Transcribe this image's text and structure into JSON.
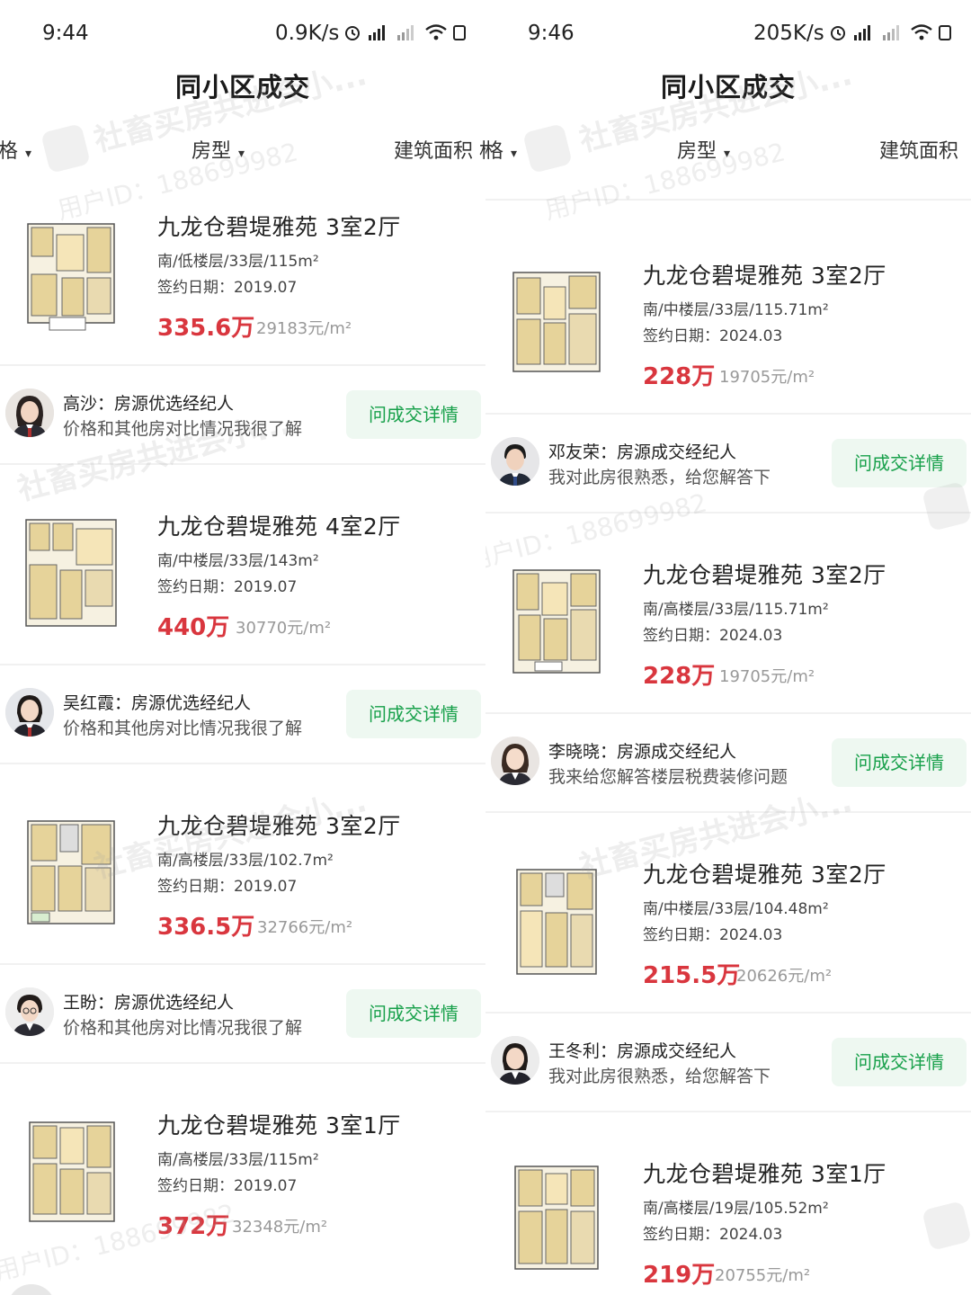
{
  "left": {
    "status": {
      "time": "9:44",
      "net_speed": "0.9K/s"
    },
    "title": "同小区成交",
    "filters": [
      {
        "label": "格"
      },
      {
        "label": "房型"
      },
      {
        "label": "建筑面积 格"
      }
    ],
    "listings": [
      {
        "name": "九龙仓碧堤雅苑 3室2厅",
        "meta": "南/低楼层/33层/115m²",
        "date": "签约日期：2019.07",
        "price": "335.6万",
        "unit_price": "29183元/m²"
      },
      {
        "name": "九龙仓碧堤雅苑 4室2厅",
        "meta": "南/中楼层/33层/143m²",
        "date": "签约日期：2019.07",
        "price": "440万",
        "unit_price": "30770元/m²"
      },
      {
        "name": "九龙仓碧堤雅苑 3室2厅",
        "meta": "南/高楼层/33层/102.7m²",
        "date": "签约日期：2019.07",
        "price": "336.5万",
        "unit_price": "32766元/m²"
      },
      {
        "name": "九龙仓碧堤雅苑 3室1厅",
        "meta": "南/高楼层/33层/115m²",
        "date": "签约日期：2019.07",
        "price": "372万",
        "unit_price": "32348元/m²"
      }
    ],
    "agents": [
      {
        "name": "高沙：房源优选经纪人",
        "message": "价格和其他房对比情况我很了解",
        "button": "问成交详情"
      },
      {
        "name": "吴红霞：房源优选经纪人",
        "message": "价格和其他房对比情况我很了解",
        "button": "问成交详情"
      },
      {
        "name": "王盼：房源优选经纪人",
        "message": "价格和其他房对比情况我很了解",
        "button": "问成交详情"
      }
    ]
  },
  "right": {
    "status": {
      "time": "9:46",
      "net_speed": "205K/s"
    },
    "title": "同小区成交",
    "filters": [
      {
        "label": "格"
      },
      {
        "label": "房型"
      },
      {
        "label": "建筑面积"
      }
    ],
    "listings": [
      {
        "name": "九龙仓碧堤雅苑 3室2厅",
        "meta": "南/中楼层/33层/115.71m²",
        "date": "签约日期：2024.03",
        "price": "228万",
        "unit_price": "19705元/m²"
      },
      {
        "name": "九龙仓碧堤雅苑 3室2厅",
        "meta": "南/高楼层/33层/115.71m²",
        "date": "签约日期：2024.03",
        "price": "228万",
        "unit_price": "19705元/m²"
      },
      {
        "name": "九龙仓碧堤雅苑 3室2厅",
        "meta": "南/中楼层/33层/104.48m²",
        "date": "签约日期：2024.03",
        "price": "215.5万",
        "unit_price": "20626元/m²"
      },
      {
        "name": "九龙仓碧堤雅苑 3室1厅",
        "meta": "南/高楼层/19层/105.52m²",
        "date": "签约日期：2024.03",
        "price": "219万",
        "unit_price": "20755元/m²"
      }
    ],
    "agents": [
      {
        "name": "邓友荣：房源成交经纪人",
        "message": "我对此房很熟悉，给您解答下",
        "button": "问成交详情"
      },
      {
        "name": "李晓晓：房源成交经纪人",
        "message": "我来给您解答楼层税费装修问题",
        "button": "问成交详情"
      },
      {
        "name": "王冬利：房源成交经纪人",
        "message": "我对此房很熟悉，给您解答下",
        "button": "问成交详情"
      }
    ]
  },
  "watermark": {
    "text": "社畜买房共进会小...",
    "user_id": "用户ID：188699982"
  },
  "colors": {
    "price": "#d9363e",
    "button_text": "#17a04a",
    "button_bg": "#eef8f1"
  }
}
